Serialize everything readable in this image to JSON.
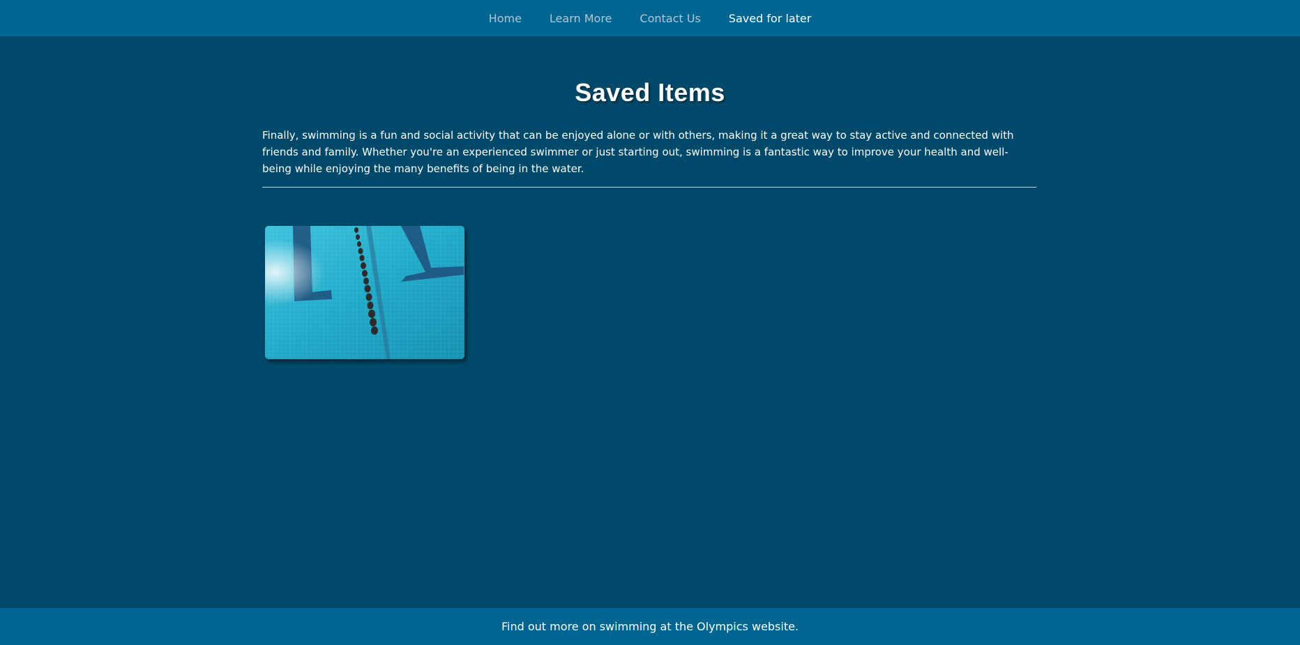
{
  "nav": {
    "items": [
      {
        "label": "Home"
      },
      {
        "label": "Learn More"
      },
      {
        "label": "Contact Us"
      },
      {
        "label": "Saved for later",
        "active": true
      }
    ]
  },
  "main": {
    "title": "Saved Items",
    "intro": "Finally, swimming is a fun and social activity that can be enjoyed alone or with others, making it a great way to stay active and connected with friends and family. Whether you're an experienced swimmer or just starting out, swimming is a fantastic way to improve your health and well-being while enjoying the many benefits of being in the water.",
    "saved_items": [
      {
        "image": "swimming-pool-lane-photo"
      }
    ]
  },
  "footer": {
    "text": "Find out more on swimming at the Olympics website."
  },
  "colors": {
    "background": "#00496b",
    "bar": "#006591",
    "nav_inactive": "#b3c7d3",
    "text": "#ffffff"
  }
}
